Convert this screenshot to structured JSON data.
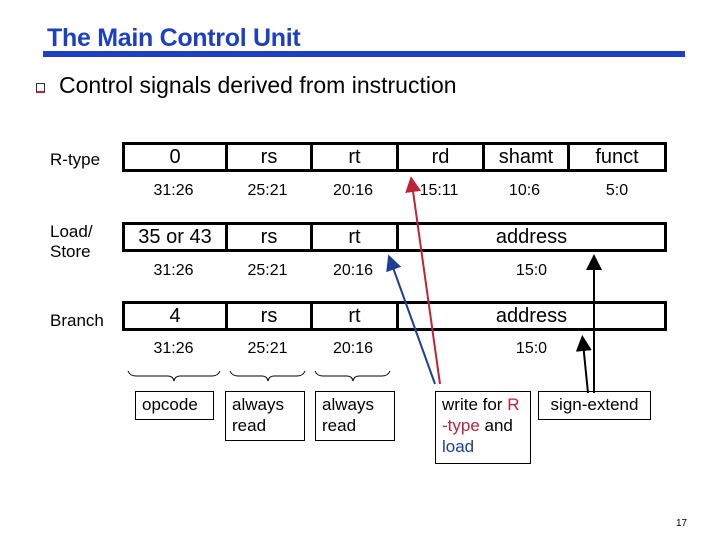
{
  "slide": {
    "title": "The Main Control Unit",
    "bullet": "Control signals derived from instruction",
    "page_number": "17"
  },
  "formats": {
    "rtype": {
      "label": "R-type",
      "fields": [
        "0",
        "rs",
        "rt",
        "rd",
        "shamt",
        "funct"
      ],
      "bits": [
        "31:26",
        "25:21",
        "20:16",
        "15:11",
        "10:6",
        "5:0"
      ]
    },
    "loadstore": {
      "label_line1": "Load/",
      "label_line2": "Store",
      "fields": [
        "35 or 43",
        "rs",
        "rt",
        "address"
      ],
      "bits": [
        "31:26",
        "25:21",
        "20:16",
        "15:0"
      ]
    },
    "branch": {
      "label": "Branch",
      "fields": [
        "4",
        "rs",
        "rt",
        "address"
      ],
      "bits": [
        "31:26",
        "25:21",
        "20:16",
        "15:0"
      ]
    }
  },
  "annotations": {
    "opcode": "opcode",
    "rs_note_line1": "always",
    "rs_note_line2": "read",
    "rt_note_line1": "always",
    "rt_note_line2": "read",
    "write_note": {
      "part1": "write for ",
      "part2": "R",
      "part3": "-type",
      "part4": " and",
      "part5": "load"
    },
    "sign_extend": "sign-extend"
  },
  "colors": {
    "title": "#1c3fc4",
    "rtype_arrow": "#c0223a",
    "load_arrow": "#1c3f96"
  }
}
